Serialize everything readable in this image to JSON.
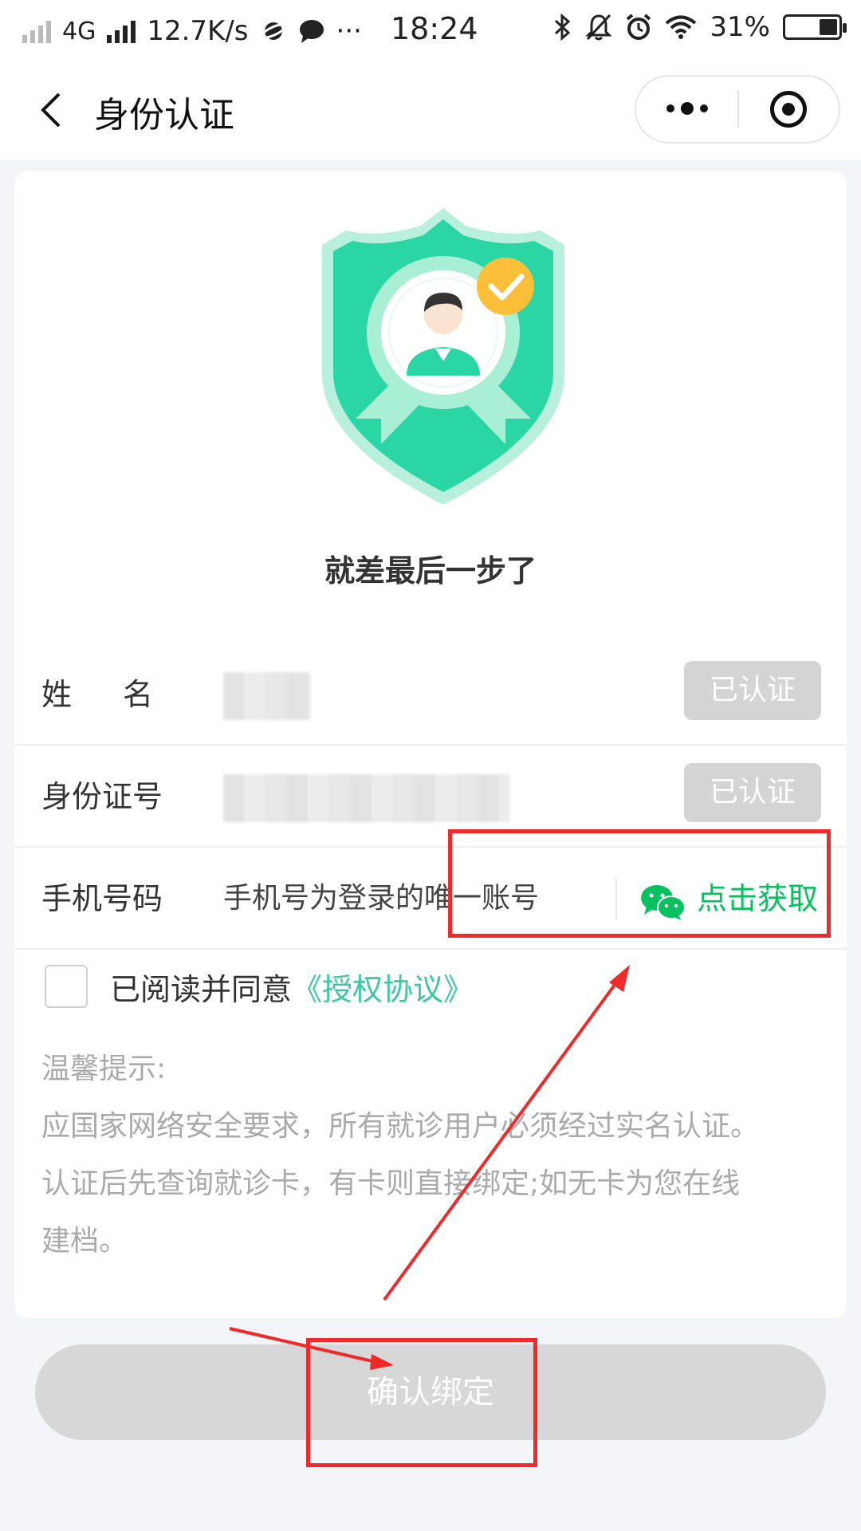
{
  "status_bar": {
    "network": "4G",
    "speed": "12.7K/s",
    "time": "18:24",
    "battery": "31%",
    "icons": [
      "signal-icon",
      "planet-icon",
      "chat-bubble-icon",
      "more-dots-icon",
      "bluetooth-icon",
      "mute-icon",
      "alarm-icon",
      "wifi-icon",
      "battery-icon"
    ],
    "more_glyph": "···"
  },
  "nav": {
    "title": "身份认证"
  },
  "headline": "就差最后一步了",
  "rows": {
    "name": {
      "label": "姓名",
      "badge": "已认证"
    },
    "id": {
      "label": "身份证号",
      "badge": "已认证"
    },
    "phone": {
      "label": "手机号码",
      "placeholder": "手机号为登录的唯一账号",
      "action": "点击获取"
    }
  },
  "agreement": {
    "text": "已阅读并同意",
    "link": "《授权协议》",
    "checked": false
  },
  "tips": {
    "title": "温馨提示:",
    "lines": [
      "应国家网络安全要求，所有就诊用户必须经过实名认证。",
      "认证后先查询就诊卡，有卡则直接绑定;如无卡为您在线",
      "建档。"
    ]
  },
  "confirm_button": "确认绑定",
  "colors": {
    "accent_green": "#07c160",
    "link_teal": "#3ec7a0",
    "shield_green": "#2bd6a5",
    "annotation_red": "#f02a2a",
    "disabled_gray": "#d4d4d4"
  }
}
